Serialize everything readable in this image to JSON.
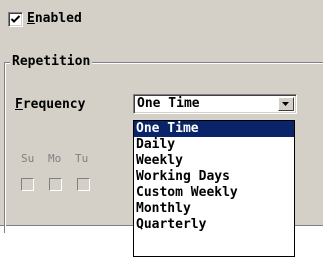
{
  "enabled": {
    "checked": true,
    "label_first": "E",
    "label_rest": "nabled"
  },
  "repetition": {
    "title": "Repetition"
  },
  "frequency": {
    "label_first": "F",
    "label_rest": "requency",
    "selected": "One Time",
    "options": [
      "One Time",
      "Daily",
      "Weekly",
      "Working Days",
      "Custom Weekly",
      "Monthly",
      "Quarterly"
    ],
    "highlighted_index": 0
  },
  "weekdays": {
    "labels": [
      "Su",
      "Mo",
      "Tu"
    ]
  },
  "colors": {
    "panel": "#d4d0c8",
    "selection": "#0a246a",
    "disabled_text": "#808080"
  },
  "icons": {
    "check": "check-mark-icon",
    "dropdown": "dropdown-arrow-icon"
  }
}
